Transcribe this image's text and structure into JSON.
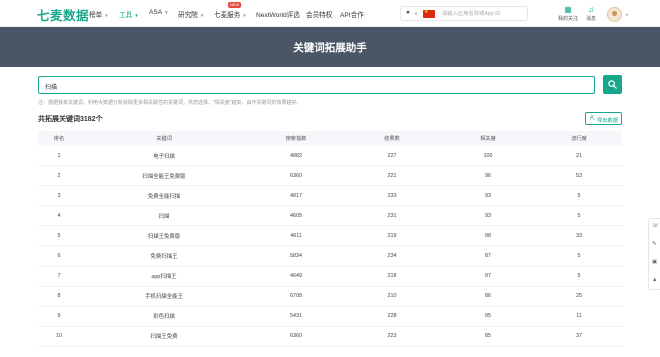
{
  "header": {
    "logo": "七麦数据",
    "nav": [
      {
        "label": "榜单",
        "active": false,
        "caret": true
      },
      {
        "label": "工具",
        "active": true,
        "caret": true
      },
      {
        "label": "ASA",
        "active": false,
        "caret": true
      },
      {
        "label": "研究院",
        "active": false,
        "caret": true
      },
      {
        "label": "七麦服务",
        "active": false,
        "caret": true
      },
      {
        "label": "NextWorld评选",
        "active": false,
        "caret": false
      },
      {
        "label": "会员特权",
        "active": false,
        "caret": false
      },
      {
        "label": "API合作",
        "active": false,
        "caret": false
      }
    ],
    "new_badge": "NEW",
    "search_placeholder": "请输入应用名称或App ID",
    "my_follow": "我的关注",
    "messages": "消息",
    "accent_color": "#17a88b"
  },
  "banner": {
    "title": "关键词拓展助手",
    "bg_color": "#4a5566"
  },
  "search": {
    "value": "扫描",
    "note": "注：根据我有关键词，利用大数据分析获取更多相关联性的关键词，供您选择。\"相关度\"越高，由作关键词的效果越好。"
  },
  "results": {
    "total_label": "共拓展关键词3182个",
    "export_label": "导出数据"
  },
  "table": {
    "headers": [
      "排名",
      "关键词",
      "搜索指数",
      "结果数",
      "相关度",
      "流行度"
    ],
    "rows": [
      [
        "1",
        "电子扫描",
        "4882",
        "227",
        "100",
        "21"
      ],
      [
        "2",
        "扫描全能王免费版",
        "6360",
        "221",
        "96",
        "53"
      ],
      [
        "3",
        "免费全能扫描",
        "4817",
        "233",
        "93",
        "5"
      ],
      [
        "4",
        "扫描",
        "4605",
        "231",
        "93",
        "5"
      ],
      [
        "5",
        "扫描王免费版",
        "4611",
        "219",
        "88",
        "33"
      ],
      [
        "6",
        "免费扫描王",
        "5834",
        "234",
        "87",
        "5"
      ],
      [
        "7",
        "app扫描王",
        "4649",
        "218",
        "87",
        "5"
      ],
      [
        "8",
        "手机扫描全能王",
        "6708",
        "210",
        "86",
        "25"
      ],
      [
        "9",
        "彩色扫描",
        "5431",
        "228",
        "85",
        "11"
      ],
      [
        "10",
        "扫描王免费",
        "6360",
        "223",
        "85",
        "37"
      ]
    ]
  }
}
